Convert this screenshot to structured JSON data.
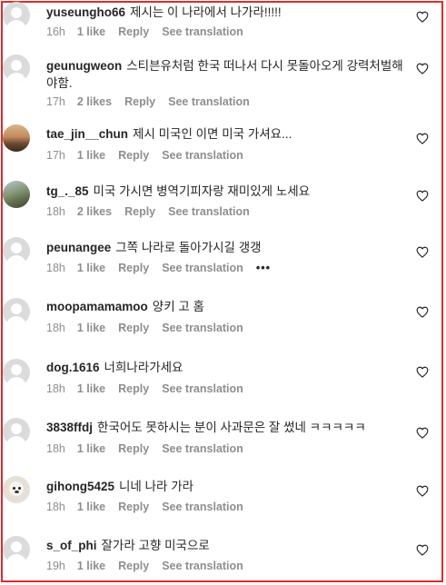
{
  "actions": {
    "reply": "Reply",
    "see_translation": "See translation",
    "more": "•••"
  },
  "comments": [
    {
      "username": "yuseungho66",
      "text": "제시는 이 나라에서 나가라!!!!!",
      "time": "16h",
      "likes": "1 like",
      "avatar": "default"
    },
    {
      "username": "geunugweon",
      "text": "스티븐유처럼 한국 떠나서 다시 못돌아오게 강력처벌해야함.",
      "time": "17h",
      "likes": "2 likes",
      "avatar": "default"
    },
    {
      "username": "tae_jin__chun",
      "text": "제시 미국인 이면 미국 가셔요...",
      "time": "17h",
      "likes": "1 like",
      "avatar": "photo-sunset"
    },
    {
      "username": "tg_._85",
      "text": "미국 가시면 병역기피자랑 재미있게 노세요",
      "time": "18h",
      "likes": "2 likes",
      "avatar": "photo-landscape"
    },
    {
      "username": "peunangee",
      "text": "그쪽 나라로 돌아가시길 갱갱",
      "time": "18h",
      "likes": "1 like",
      "avatar": "default"
    },
    {
      "username": "moopamamamoo",
      "text": "양키 고 홈",
      "time": "18h",
      "likes": "1 like",
      "avatar": "default"
    },
    {
      "username": "dog.1616",
      "text": "너희나라가세요",
      "time": "18h",
      "likes": "1 like",
      "avatar": "default"
    },
    {
      "username": "3838ffdj",
      "text": "한국어도 못하시는 분이 사과문은 잘 썼네 ㅋㅋㅋㅋㅋ",
      "time": "18h",
      "likes": "1 like",
      "avatar": "default"
    },
    {
      "username": "gihong5425",
      "text": "니네 나라 가라",
      "time": "18h",
      "likes": "1 like",
      "avatar": "photo-dog"
    },
    {
      "username": "s_of_phi",
      "text": "잘가라 고향 미국으로",
      "time": "19h",
      "likes": "1 like",
      "avatar": "default"
    }
  ]
}
